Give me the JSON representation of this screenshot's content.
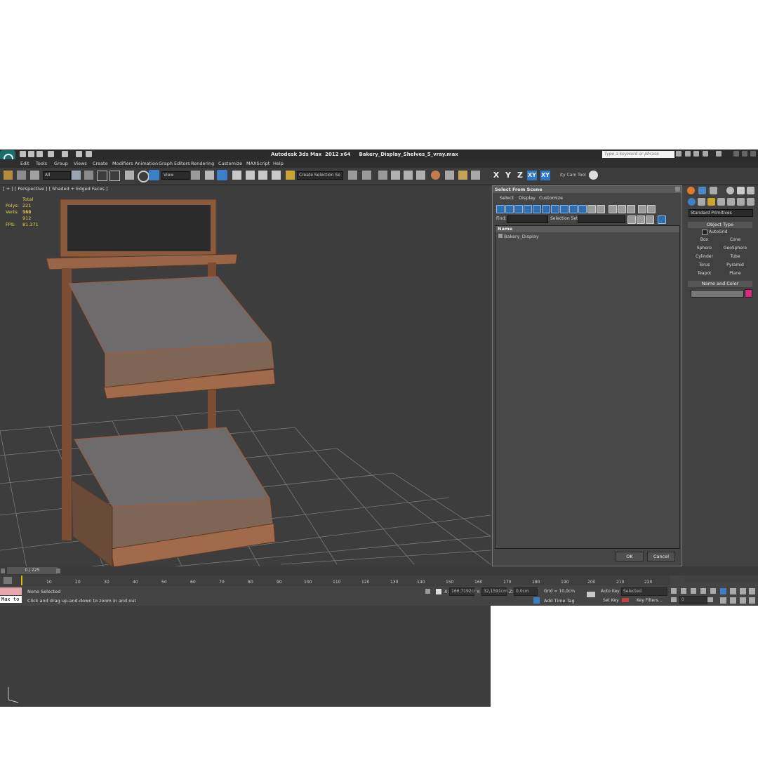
{
  "title": {
    "app": "Autodesk 3ds Max  2012 x64",
    "file": "Bakery_Display_Shelves_5_vray.max",
    "search_placeholder": "Type a keyword or phrase"
  },
  "menu": [
    "Edit",
    "Tools",
    "Group",
    "Views",
    "Create",
    "Modifiers",
    "Animation",
    "Graph Editors",
    "Rendering",
    "Customize",
    "MAXScript",
    "Help"
  ],
  "toolbar": {
    "filter": "All",
    "ref_coord": "View",
    "selection_set": "Create Selection Se",
    "axis": [
      "X",
      "Y",
      "Z",
      "XY",
      "XY"
    ],
    "cam_tool": "ity Cam Tool"
  },
  "viewport": {
    "label": "[ + ] [ Perspective ] [ Shaded + Edged Faces ]",
    "stats_total": "Total",
    "polys_label": "Polys:",
    "polys": "221 560",
    "verts_label": "Verts:",
    "verts": "111 912",
    "fps_label": "FPS:",
    "fps": "81.371"
  },
  "dialog": {
    "title": "Select From Scene",
    "menu": [
      "Select",
      "Display",
      "Customize"
    ],
    "find_label": "Find:",
    "selset_label": "Selection Set:",
    "col_name": "Name",
    "items": [
      "Bakery_Display"
    ],
    "ok": "OK",
    "cancel": "Cancel"
  },
  "command_panel": {
    "category": "Standard Primitives",
    "object_type": "Object Type",
    "autogrid": "AutoGrid",
    "buttons": [
      "Box",
      "Cone",
      "Sphere",
      "GeoSphere",
      "Cylinder",
      "Tube",
      "Torus",
      "Pyramid",
      "Teapot",
      "Plane"
    ],
    "name_and_color": "Name and Color",
    "swatch_color": "#e0267d"
  },
  "timeline": {
    "frame": "0 / 225",
    "ticks": [
      "10",
      "20",
      "30",
      "40",
      "50",
      "60",
      "70",
      "80",
      "90",
      "100",
      "110",
      "120",
      "130",
      "140",
      "150",
      "160",
      "170",
      "180",
      "190",
      "200",
      "210",
      "220"
    ]
  },
  "status": {
    "maxscript": "Max to",
    "selection": "None Selected",
    "prompt": "Click and drag up-and-down to zoom in and out",
    "x_label": "X:",
    "x": "166,7192cr",
    "y_label": "Y:",
    "y": "32,1591cm",
    "z_label": "Z:",
    "z": "0,0cm",
    "grid": "Grid = 10,0cm",
    "add_time_tag": "Add Time Tag",
    "auto_key": "Auto Key",
    "set_key": "Set Key",
    "selected": "Selected",
    "key_filters": "Key Filters...",
    "frame_field": "0"
  }
}
